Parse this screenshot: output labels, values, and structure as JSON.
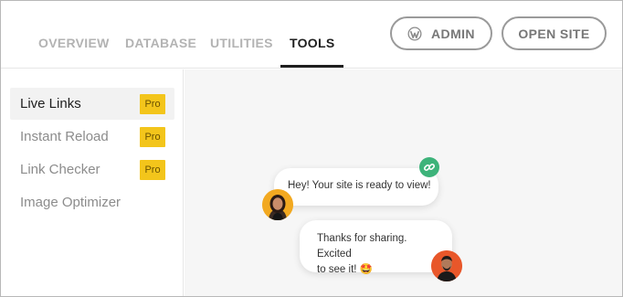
{
  "header": {
    "tabs": [
      {
        "label": "OVERVIEW",
        "active": false
      },
      {
        "label": "DATABASE",
        "active": false
      },
      {
        "label": "UTILITIES",
        "active": false
      },
      {
        "label": "TOOLS",
        "active": true
      }
    ],
    "admin_button": {
      "label": "ADMIN",
      "icon": "wordpress-icon"
    },
    "open_site_button": {
      "label": "OPEN SITE"
    }
  },
  "sidebar": {
    "items": [
      {
        "label": "Live Links",
        "badge": "Pro",
        "active": true
      },
      {
        "label": "Instant Reload",
        "badge": "Pro",
        "active": false
      },
      {
        "label": "Link Checker",
        "badge": "Pro",
        "active": false
      },
      {
        "label": "Image Optimizer",
        "badge": "",
        "active": false
      }
    ]
  },
  "main": {
    "message1": "Hey! Your site is ready to view!",
    "message2_line1": "Thanks for sharing. Excited",
    "message2_line2": "to see it! 🤩",
    "link_icon": "link-icon",
    "avatar1": "woman-avatar",
    "avatar2": "man-avatar"
  },
  "colors": {
    "pro_badge": "#f3c51b",
    "link_badge": "#3db37a",
    "active_tab": "#1f1f1f",
    "inactive_tab": "#b3b3b3",
    "main_bg": "#f6f6f6"
  }
}
